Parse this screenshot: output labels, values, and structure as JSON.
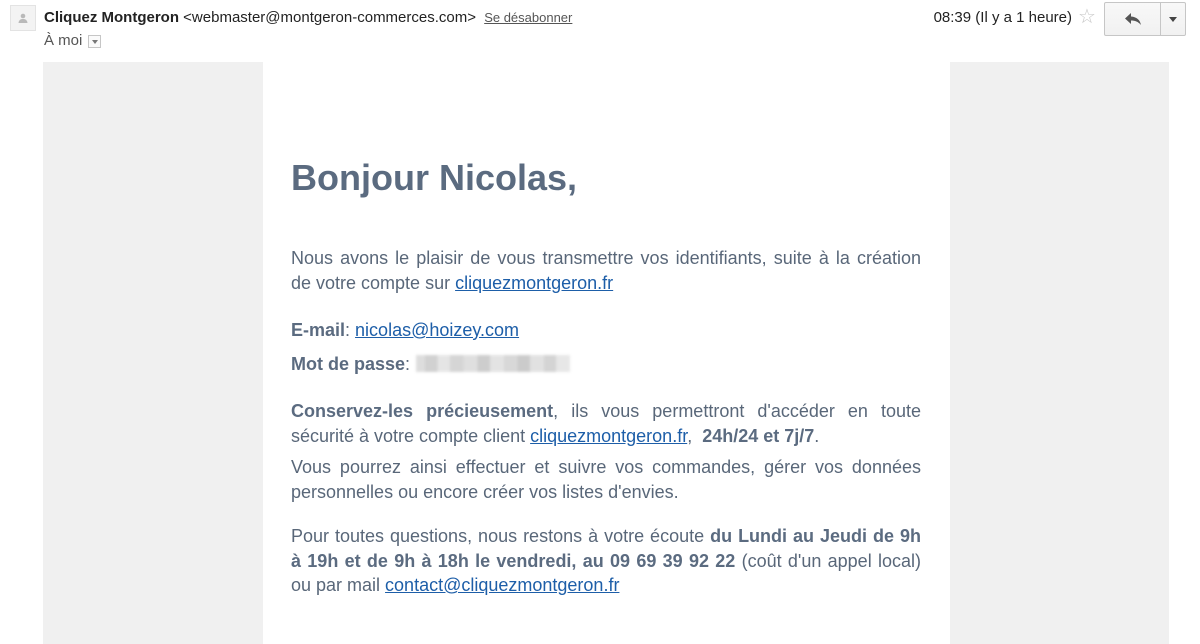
{
  "header": {
    "sender_name": "Cliquez Montgeron",
    "sender_email": "<webmaster@montgeron-commerces.com>",
    "unsubscribe_label": "Se désabonner",
    "recipient": "À moi",
    "time": "08:39 (Il y a 1 heure)"
  },
  "icons": {
    "avatar": "person-icon",
    "star": "star-icon",
    "reply": "reply-arrow-icon",
    "more": "chevron-down-icon"
  },
  "colors": {
    "heading": "#5b6b80",
    "body_text": "#596779",
    "link": "#1d5ea8",
    "email_background": "#f0f0f0"
  },
  "email": {
    "greeting": "Bonjour Nicolas,",
    "intro_text": "Nous avons le plaisir de vous transmettre vos identifiants, suite à la création de votre compte sur ",
    "intro_link": "cliquezmontgeron.fr",
    "email_label": "E-mail",
    "email_value": "nicolas@hoizey.com",
    "password_label": "Mot de passe",
    "keep_bold": "Conservez-les précieusement",
    "keep_text": ", ils vous permettront d'accéder en toute sécurité à votre compte client ",
    "keep_link": "cliquezmontgeron.fr",
    "keep_hours": "24h/24 et 7j/7",
    "manage_text": "Vous pourrez ainsi effectuer et suivre vos commandes, gérer vos données personnelles ou encore créer vos listes d'envies.",
    "contact_text_1": "Pour toutes questions, nous restons à votre écoute ",
    "contact_bold": "du Lundi au Jeudi de 9h à 19h et de 9h à 18h le vendredi, au 09 69 39 92 22",
    "contact_text_2": " (coût d'un appel local) ou par mail ",
    "contact_link": "contact@cliquezmontgeron.fr"
  }
}
